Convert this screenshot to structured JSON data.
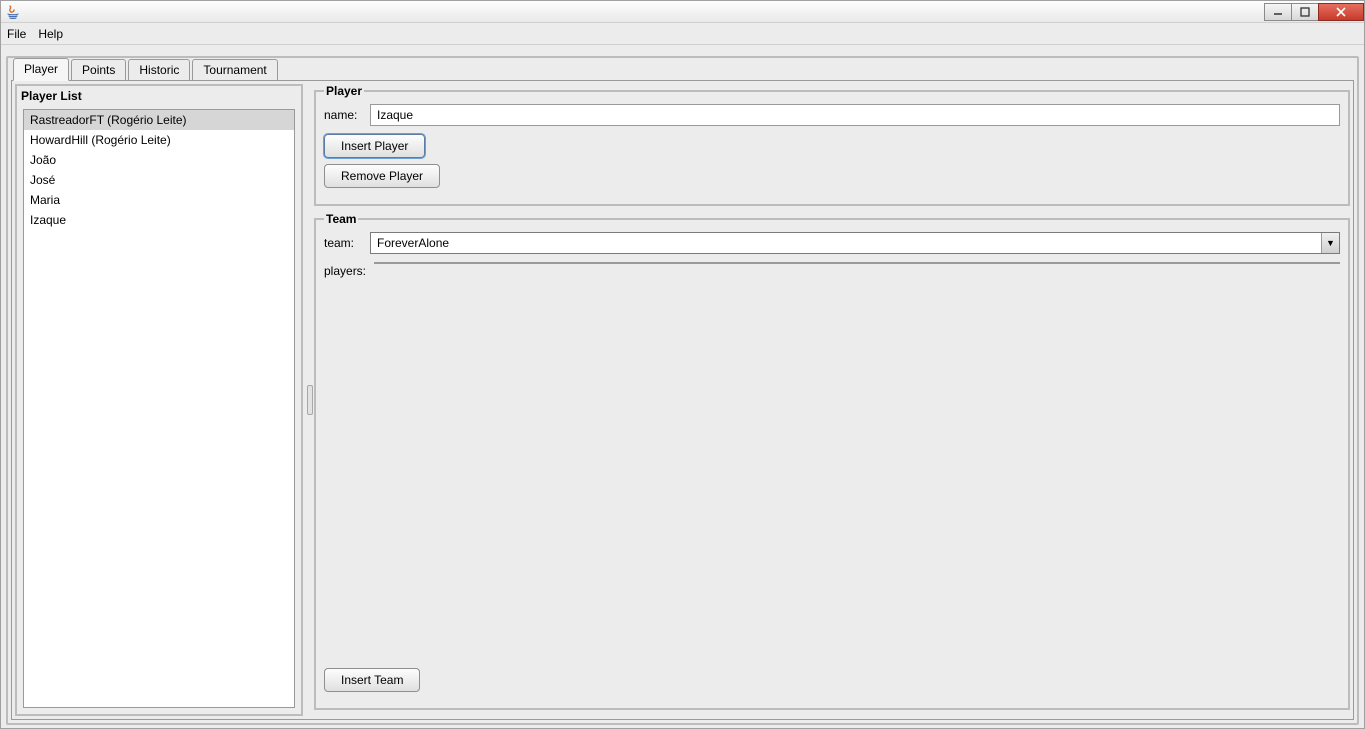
{
  "menubar": {
    "file": "File",
    "help": "Help"
  },
  "tabs": {
    "player": "Player",
    "points": "Points",
    "historic": "Historic",
    "tournament": "Tournament"
  },
  "playerList": {
    "title": "Player List",
    "items": [
      "RastreadorFT (Rogério Leite)",
      "HowardHill (Rogério Leite)",
      "João",
      "José",
      "Maria",
      "Izaque"
    ],
    "selectedIndex": 0
  },
  "playerForm": {
    "legend": "Player",
    "nameLabel": "name:",
    "nameValue": "Izaque",
    "insertBtn": "Insert Player",
    "removeBtn": "Remove Player"
  },
  "teamForm": {
    "legend": "Team",
    "teamLabel": "team:",
    "teamValue": "ForeverAlone",
    "playersLabel": "players:",
    "insertBtn": "Insert Team"
  }
}
